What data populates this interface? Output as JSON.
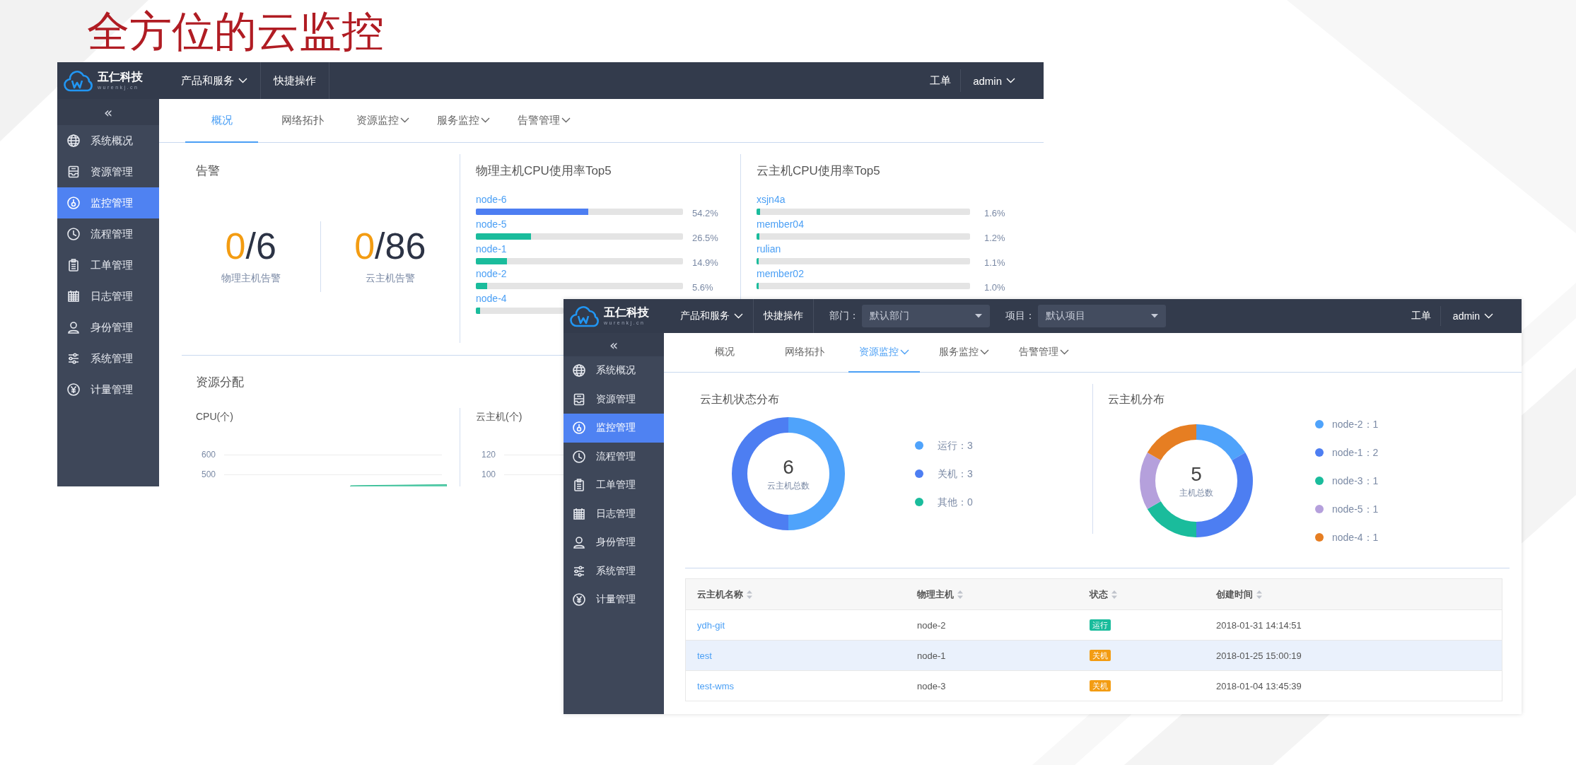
{
  "slide_title": "全方位的云监控",
  "windows": [
    {
      "logo": {
        "name": "五仁科技",
        "domain": "wurenkj.cn"
      },
      "top_menu": [
        {
          "label": "产品和服务",
          "dropdown": true
        },
        {
          "label": "快捷操作",
          "dropdown": false
        }
      ],
      "user_links": {
        "work_orders": "工单",
        "user": "admin"
      },
      "sidebar": {
        "collapse": "«",
        "items": [
          {
            "label": "系统概况",
            "selected": false
          },
          {
            "label": "资源管理",
            "selected": false
          },
          {
            "label": "监控管理",
            "selected": true
          },
          {
            "label": "流程管理",
            "selected": false
          },
          {
            "label": "工单管理",
            "selected": false
          },
          {
            "label": "日志管理",
            "selected": false
          },
          {
            "label": "身份管理",
            "selected": false
          },
          {
            "label": "系统管理",
            "selected": false
          },
          {
            "label": "计量管理",
            "selected": false
          }
        ]
      },
      "tabs": [
        {
          "label": "概况",
          "dropdown": false,
          "selected": true
        },
        {
          "label": "网络拓扑",
          "dropdown": false,
          "selected": false
        },
        {
          "label": "资源监控",
          "dropdown": true,
          "selected": false
        },
        {
          "label": "服务监控",
          "dropdown": true,
          "selected": false
        },
        {
          "label": "告警管理",
          "dropdown": true,
          "selected": false
        }
      ],
      "content": {
        "kind": "overview",
        "alarms": {
          "title": "告警",
          "counters": [
            {
              "value": "0",
              "total": "/6",
              "label": "物理主机告警"
            },
            {
              "value": "0",
              "total": "/86",
              "label": "云主机告警"
            }
          ]
        },
        "top5": [
          {
            "title": "物理主机CPU使用率Top5",
            "rows": [
              {
                "name": "node-6",
                "level": 0.542,
                "reading": "54.2%",
                "color": "#4d7ef2"
              },
              {
                "name": "node-5",
                "level": 0.265,
                "reading": "26.5%",
                "color": "#1abc9c"
              },
              {
                "name": "node-1",
                "level": 0.149,
                "reading": "14.9%",
                "color": "#1abc9c"
              },
              {
                "name": "node-2",
                "level": 0.056,
                "reading": "5.6%",
                "color": "#1abc9c"
              },
              {
                "name": "node-4",
                "level": 0.05,
                "color": "#1abc9c"
              }
            ]
          },
          {
            "title": "云主机CPU使用率Top5",
            "rows": [
              {
                "name": "xsjn4a",
                "level": 0.016,
                "reading": "1.6%",
                "color": "#1abc9c"
              },
              {
                "name": "member04",
                "level": 0.012,
                "reading": "1.2%",
                "color": "#1abc9c"
              },
              {
                "name": "rulian",
                "level": 0.011,
                "reading": "1.1%",
                "color": "#1abc9c"
              },
              {
                "name": "member02",
                "level": 0.01,
                "reading": "1.0%",
                "color": "#1abc9c"
              }
            ]
          }
        ],
        "allocation": {
          "title": "资源分配",
          "charts": [
            {
              "title": "CPU(个)",
              "yticks": [
                "600",
                "500"
              ]
            },
            {
              "title": "云主机(个)",
              "yticks": [
                "120",
                "100"
              ]
            }
          ]
        }
      }
    },
    {
      "logo": {
        "name": "五仁科技",
        "domain": "wurenkj.cn"
      },
      "top_menu": [
        {
          "label": "产品和服务",
          "dropdown": true
        },
        {
          "label": "快捷操作",
          "dropdown": false
        }
      ],
      "filters": [
        {
          "label": "部门：",
          "value": "默认部门"
        },
        {
          "label": "项目：",
          "value": "默认项目"
        }
      ],
      "user_links": {
        "work_orders": "工单",
        "user": "admin"
      },
      "sidebar": {
        "collapse": "«",
        "items": [
          {
            "label": "系统概况",
            "selected": false
          },
          {
            "label": "资源管理",
            "selected": false
          },
          {
            "label": "监控管理",
            "selected": true
          },
          {
            "label": "流程管理",
            "selected": false
          },
          {
            "label": "工单管理",
            "selected": false
          },
          {
            "label": "日志管理",
            "selected": false
          },
          {
            "label": "身份管理",
            "selected": false
          },
          {
            "label": "系统管理",
            "selected": false
          },
          {
            "label": "计量管理",
            "selected": false
          }
        ]
      },
      "tabs": [
        {
          "label": "概况",
          "dropdown": false,
          "selected": false
        },
        {
          "label": "网络拓扑",
          "dropdown": false,
          "selected": false
        },
        {
          "label": "资源监控",
          "dropdown": true,
          "selected": true
        },
        {
          "label": "服务监控",
          "dropdown": true,
          "selected": false
        },
        {
          "label": "告警管理",
          "dropdown": true,
          "selected": false
        }
      ],
      "content": {
        "kind": "resources",
        "donuts": [
          {
            "title": "云主机状态分布",
            "total": "6",
            "total_label": "云主机总数",
            "chart_data": {
              "type": "donut",
              "categories": [
                "运行：3",
                "关机：3",
                "其他：0"
              ],
              "values": [
                3,
                3,
                0
              ],
              "colors": [
                "#4fa3fb",
                "#4d7ef2",
                "#1abc9c"
              ],
              "legend": "right"
            }
          },
          {
            "title": "云主机分布",
            "total": "5",
            "total_label": "主机总数",
            "chart_data": {
              "type": "donut",
              "categories": [
                "node-2：1",
                "node-1：2",
                "node-3：1",
                "node-5：1",
                "node-4：1"
              ],
              "values": [
                1,
                2,
                1,
                1,
                1
              ],
              "colors": [
                "#4fa3fb",
                "#4d7ef2",
                "#1abc9c",
                "#b5a0dc",
                "#e67e22"
              ],
              "legend": "right"
            }
          }
        ],
        "table": {
          "columns": [
            "云主机名称",
            "物理主机",
            "状态",
            "创建时间"
          ],
          "rows": [
            {
              "name": "ydh-git",
              "host": "node-2",
              "status": {
                "label": "运行",
                "kind": "running"
              },
              "created": "2018-01-31 14:14:51",
              "hovered": false
            },
            {
              "name": "test",
              "host": "node-1",
              "status": {
                "label": "关机",
                "kind": "stopped"
              },
              "created": "2018-01-25 15:00:19",
              "hovered": true
            },
            {
              "name": "test-wms",
              "host": "node-3",
              "status": {
                "label": "关机",
                "kind": "stopped"
              },
              "created": "2018-01-04 13:45:39",
              "hovered": false
            }
          ]
        }
      }
    }
  ]
}
